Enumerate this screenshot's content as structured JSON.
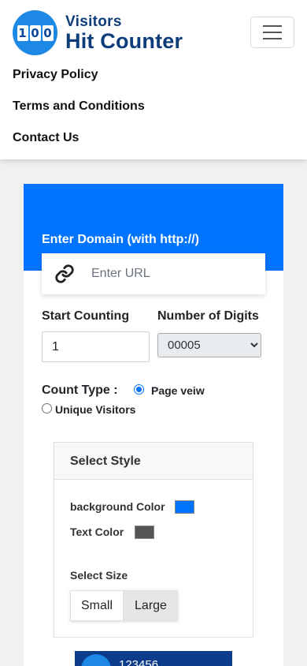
{
  "header": {
    "logo_digits": [
      "1",
      "0",
      "0"
    ],
    "logo_line1": "Visitors",
    "logo_line2": "Hit Counter",
    "nav": [
      "Privacy Policy",
      "Terms and Conditions",
      "Contact Us"
    ]
  },
  "form": {
    "domain_label": "Enter Domain (with http://)",
    "url_placeholder": "Enter URL",
    "start_label": "Start Counting",
    "start_value": "1",
    "digits_label": "Number of Digits",
    "digits_selected": "00005",
    "count_type_label": "Count Type :",
    "count_type_options": [
      "Page veiw",
      "Unique Visitors"
    ],
    "count_type_selected": "Page veiw"
  },
  "style": {
    "title": "Select Style",
    "bg_color_label": "background Color",
    "bg_color": "#0074ff",
    "text_color_label": "Text Color",
    "text_color": "#555555",
    "size_label": "Select Size",
    "sizes": [
      "Small",
      "Large"
    ],
    "size_selected": "Large"
  },
  "preview": {
    "counter_text": "123456"
  },
  "colors": {
    "brand_blue": "#0074ff",
    "logo_navy": "#0d3c7a"
  }
}
